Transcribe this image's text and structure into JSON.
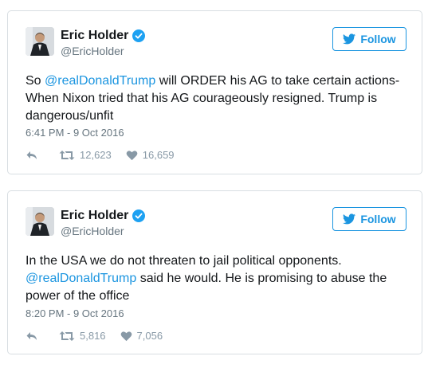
{
  "colors": {
    "link": "#1b95e0",
    "border": "#d8dee2",
    "muted": "#66757f",
    "action": "#8899a6"
  },
  "icons": [
    "verified-badge-icon",
    "twitter-bird-icon",
    "reply-icon",
    "retweet-icon",
    "heart-icon"
  ],
  "tweets": [
    {
      "name": "Eric Holder",
      "handle": "@EricHolder",
      "follow_label": "Follow",
      "text_before": "So ",
      "mention": "@realDonaldTrump",
      "text_after": " will ORDER his AG to take certain actions- When Nixon tried that his AG courageously resigned. Trump is dangerous/unfit",
      "timestamp": "6:41 PM - 9 Oct 2016",
      "retweets": "12,623",
      "likes": "16,659"
    },
    {
      "name": "Eric Holder",
      "handle": "@EricHolder",
      "follow_label": "Follow",
      "text_before": "In the USA we do not threaten to jail political opponents. ",
      "mention": "@realDonaldTrump",
      "text_after": " said he would. He is promising to abuse the power of the office",
      "timestamp": "8:20 PM - 9 Oct 2016",
      "retweets": "5,816",
      "likes": "7,056"
    }
  ]
}
